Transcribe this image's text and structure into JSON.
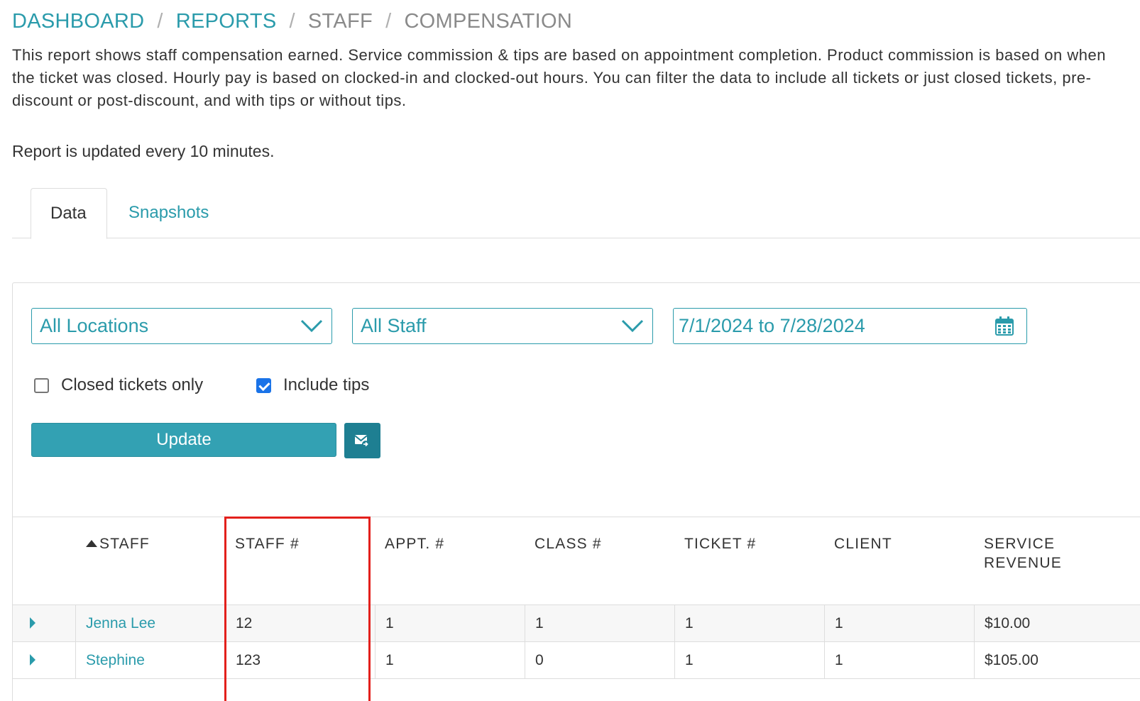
{
  "breadcrumb": {
    "items": [
      "DASHBOARD",
      "REPORTS",
      "STAFF",
      "COMPENSATION"
    ],
    "separator": "/"
  },
  "description": "This report shows staff compensation earned. Service commission & tips are based on appointment completion. Product commission is based on when the ticket was closed. Hourly pay is based on clocked-in and clocked-out hours. You can filter the data to include all tickets or just closed tickets, pre-discount or post-discount, and with tips or without tips.",
  "update_note": "Report is updated every 10 minutes.",
  "tabs": [
    {
      "label": "Data",
      "active": true
    },
    {
      "label": "Snapshots",
      "active": false
    }
  ],
  "filters": {
    "location": "All Locations",
    "staff": "All Staff",
    "date_range": "7/1/2024 to 7/28/2024",
    "closed_tickets_only": {
      "label": "Closed tickets only",
      "checked": false
    },
    "include_tips": {
      "label": "Include tips",
      "checked": true
    },
    "update_label": "Update",
    "email_icon": "email-export-icon"
  },
  "table": {
    "columns": [
      "STAFF",
      "STAFF #",
      "APPT. #",
      "CLASS #",
      "TICKET #",
      "CLIENT",
      "SERVICE\nREVENUE"
    ],
    "sort": {
      "column": "STAFF",
      "direction": "ascending"
    },
    "rows": [
      {
        "staff": "Jenna Lee",
        "staff_num": "12",
        "appt": "1",
        "class": "1",
        "ticket": "1",
        "client": "1",
        "service_revenue": "$10.00"
      },
      {
        "staff": "Stephine",
        "staff_num": "123",
        "appt": "1",
        "class": "0",
        "ticket": "1",
        "client": "1",
        "service_revenue": "$105.00"
      }
    ]
  },
  "colors": {
    "accent": "#2a9bab",
    "button": "#33a1b3",
    "email_button": "#1e7f92",
    "highlight": "#e3201c",
    "checkbox_checked": "#1a73e8"
  }
}
